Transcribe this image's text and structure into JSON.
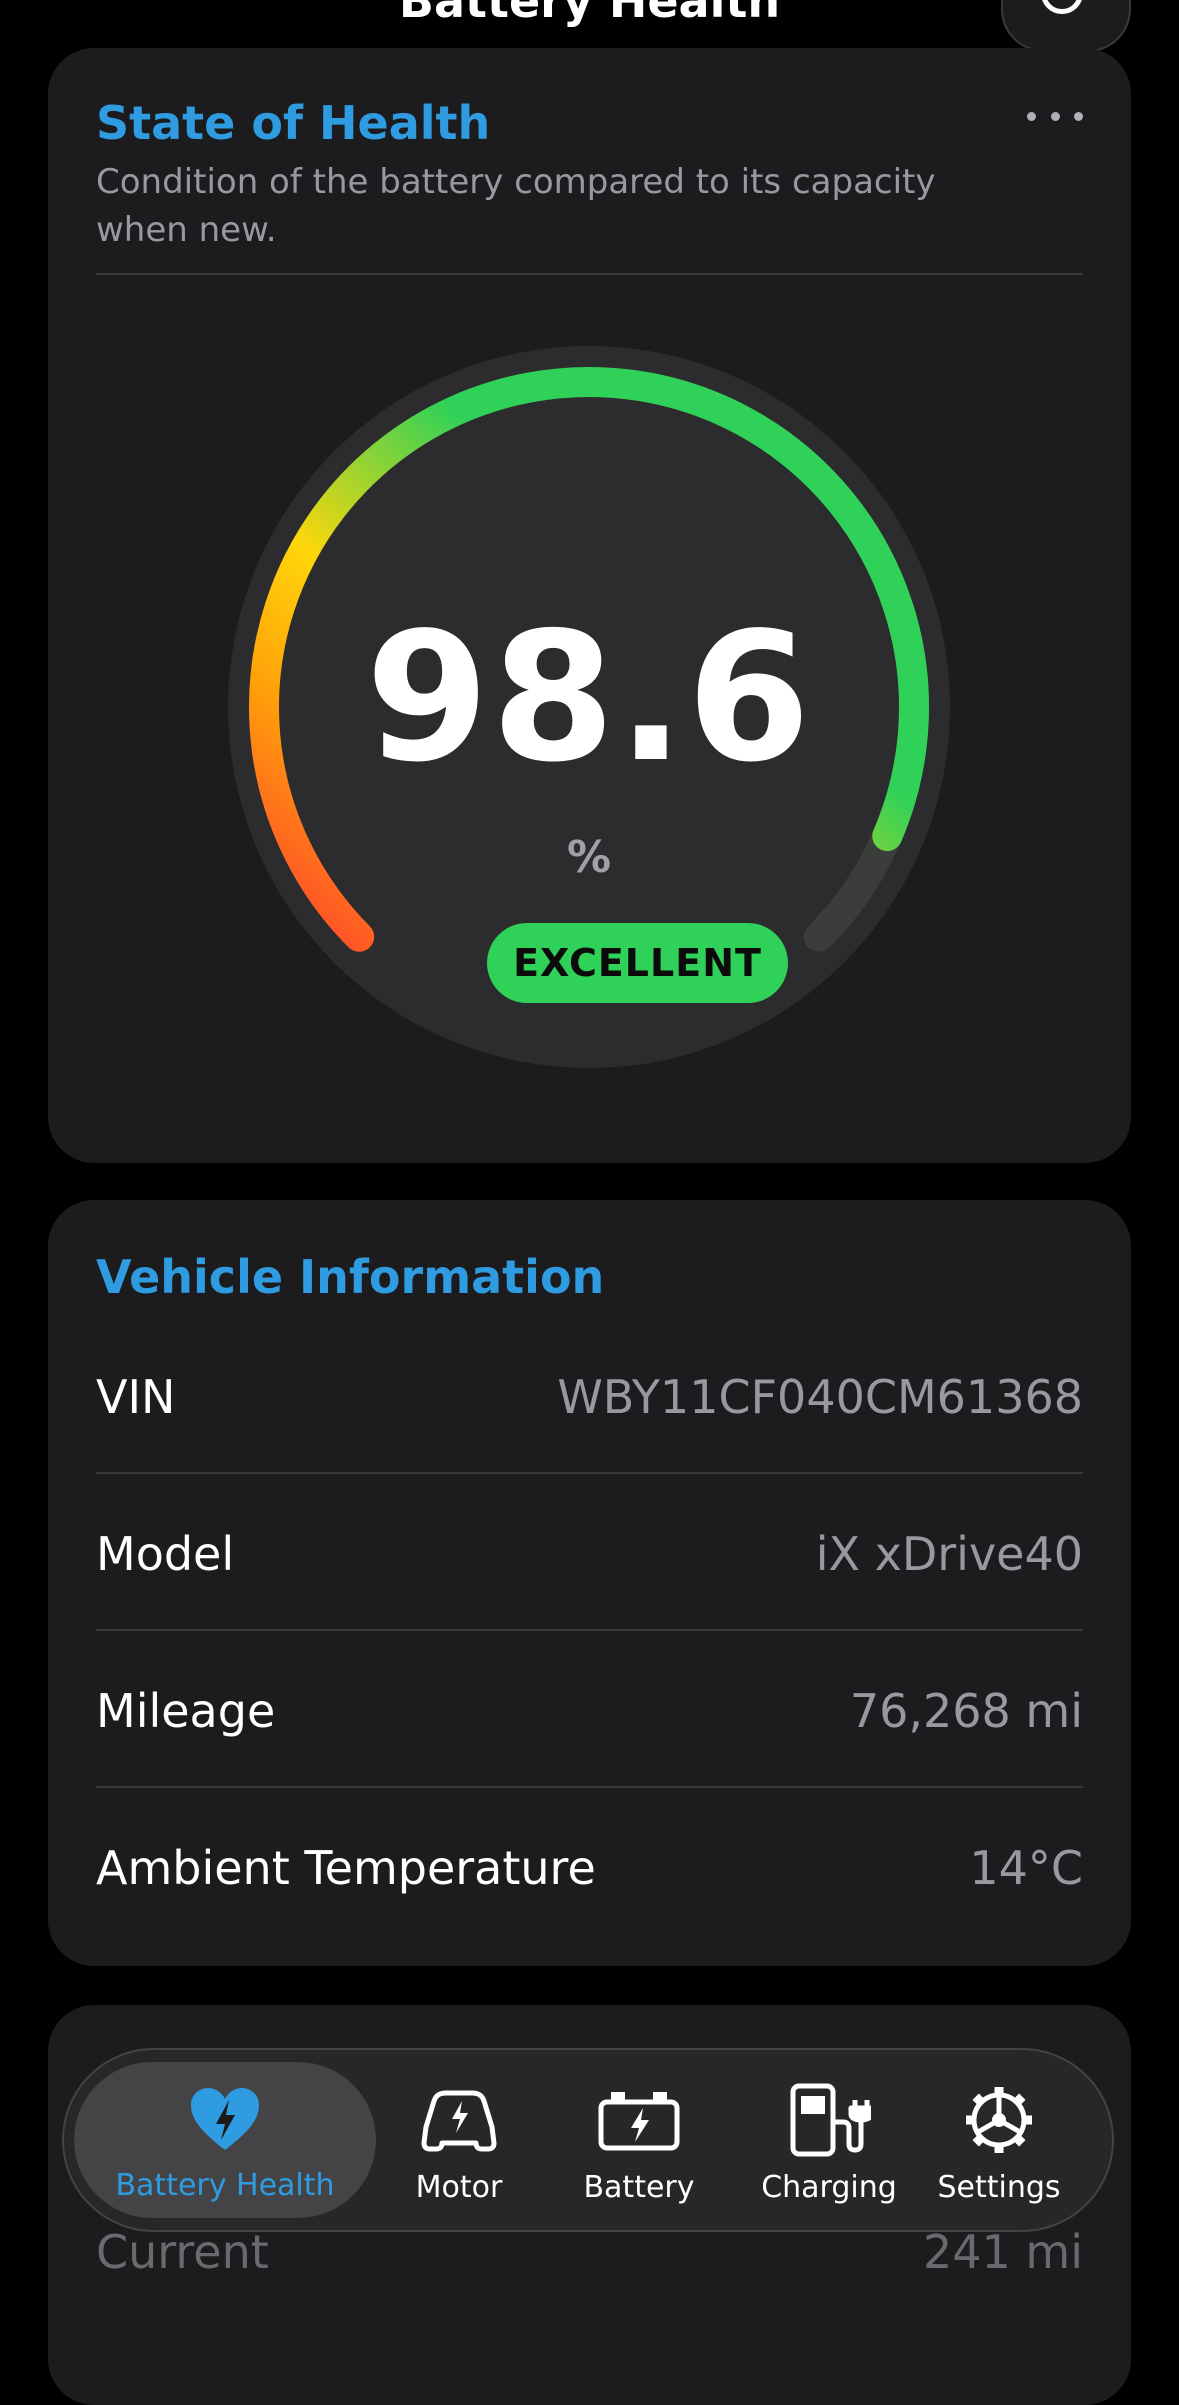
{
  "nav": {
    "title": "Battery Health"
  },
  "state_of_health": {
    "title": "State of Health",
    "subtitle": "Condition of the battery compared to its capacity when new.",
    "value": "98.6",
    "unit": "%",
    "percent": 98.6,
    "status": "EXCELLENT",
    "status_color": "#30d158",
    "gauge_colors": [
      "#ff3b30",
      "#ff9f0a",
      "#ffd60a",
      "#30d158"
    ],
    "more_icon": "ellipsis-icon"
  },
  "vehicle_info": {
    "title": "Vehicle Information",
    "rows": [
      {
        "label": "VIN",
        "value": "WBY11CF040CM61368"
      },
      {
        "label": "Model",
        "value": "iX xDrive40"
      },
      {
        "label": "Mileage",
        "value": "76,268 mi"
      },
      {
        "label": "Ambient Temperature",
        "value": "14°C"
      }
    ]
  },
  "next_card": {
    "row_label": "Current",
    "row_value": "241 mi"
  },
  "tab_bar": {
    "active_color": "#2f9be0",
    "tabs": [
      {
        "label": "Battery Health",
        "icon": "heart-bolt-icon",
        "active": true
      },
      {
        "label": "Motor",
        "icon": "car-bolt-icon",
        "active": false
      },
      {
        "label": "Battery",
        "icon": "battery-bolt-icon",
        "active": false
      },
      {
        "label": "Charging",
        "icon": "ev-charger-icon",
        "active": false
      },
      {
        "label": "Settings",
        "icon": "gear-icon",
        "active": false
      }
    ]
  },
  "colors": {
    "accent": "#2f9be0",
    "card_bg": "#1c1c1e",
    "secondary_text": "#98989f"
  }
}
